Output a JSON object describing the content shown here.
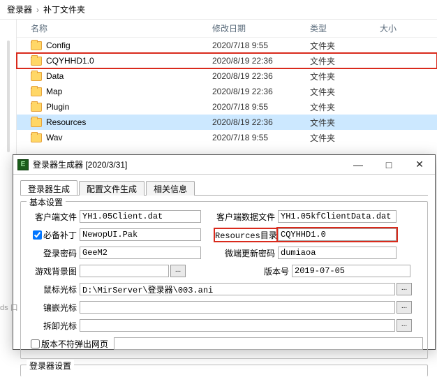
{
  "breadcrumb": {
    "part1": "登录器",
    "sep": "›",
    "part2": "补丁文件夹"
  },
  "explorer": {
    "cols": {
      "name": "名称",
      "mod": "修改日期",
      "type": "类型",
      "size": "大小"
    },
    "rows": [
      {
        "name": "Config",
        "mod": "2020/7/18 9:55",
        "type": "文件夹",
        "hl": false,
        "sel": false
      },
      {
        "name": "CQYHHD1.0",
        "mod": "2020/8/19 22:36",
        "type": "文件夹",
        "hl": true,
        "sel": false
      },
      {
        "name": "Data",
        "mod": "2020/8/19 22:36",
        "type": "文件夹",
        "hl": false,
        "sel": false
      },
      {
        "name": "Map",
        "mod": "2020/8/19 22:36",
        "type": "文件夹",
        "hl": false,
        "sel": false
      },
      {
        "name": "Plugin",
        "mod": "2020/7/18 9:55",
        "type": "文件夹",
        "hl": false,
        "sel": false
      },
      {
        "name": "Resources",
        "mod": "2020/8/19 22:36",
        "type": "文件夹",
        "hl": false,
        "sel": true
      },
      {
        "name": "Wav",
        "mod": "2020/7/18 9:55",
        "type": "文件夹",
        "hl": false,
        "sel": false
      }
    ]
  },
  "dialog": {
    "title": "登录器生成器 [2020/3/31]",
    "tabs": [
      "登录器生成",
      "配置文件生成",
      "相关信息"
    ],
    "group1": "基本设置",
    "labels": {
      "clientFile": "客户端文件",
      "clientDataFile": "客户端数据文件",
      "patch": "必备补丁",
      "resDir": "Resources目录",
      "loginPwd": "登录密码",
      "updatePwd": "微端更新密码",
      "bgImg": "游戏背景图",
      "version": "版本号",
      "cursor": "鼠标光标",
      "embedCursor": "镶嵌光标",
      "unloadCursor": "拆卸光标",
      "popup": "版本不符弹出网页"
    },
    "values": {
      "clientFile": "YH1.05Client.dat",
      "clientDataFile": "YH1.05kfClientData.dat",
      "patch": "NewopUI.Pak",
      "resDir": "CQYHHD1.0",
      "loginPwd": "GeeM2",
      "updatePwd": "dumiaoa",
      "bgImg": "",
      "version": "2019-07-05",
      "cursor": "D:\\MirServer\\登录器\\003.ani",
      "embedCursor": "",
      "unloadCursor": "",
      "popup": ""
    },
    "group2": "登录器设置",
    "browse": "..."
  },
  "leftbleed": "ds\n口"
}
